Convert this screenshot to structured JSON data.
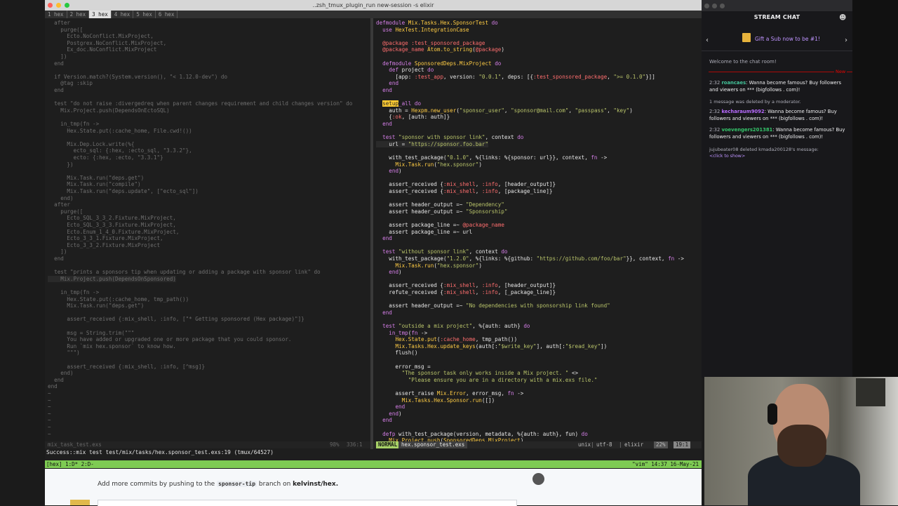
{
  "terminal": {
    "title": "..zsh_tmux_plugin_run new-session -s elixir",
    "tabs": [
      {
        "label": "1 hex",
        "active": false
      },
      {
        "label": "2 hex",
        "active": false
      },
      {
        "label": "3 hex",
        "active": true
      },
      {
        "label": "4 hex",
        "active": false
      },
      {
        "label": "5 hex",
        "active": false
      },
      {
        "label": "6 hex",
        "active": false
      }
    ],
    "left_lines": [
      "  after",
      "    purge([",
      "      Ecto.NoConflict.MixProject,",
      "      Postgrex.NoConflict.MixProject,",
      "      Ex_doc.NoConflict.MixProject",
      "    ])",
      "  end",
      "",
      "  if Version.match?(System.version(), \"< 1.12.0-dev\") do",
      "    @tag :skip",
      "  end",
      "",
      "  test \"do not raise :divergedreq when parent changes requirement and child changes version\" do",
      "    Mix.Project.push(DependsOnEctoSQL)",
      "",
      "    in_tmp(fn ->",
      "      Hex.State.put(:cache_home, File.cwd!())",
      "",
      "      Mix.Dep.Lock.write(%{",
      "        ecto_sql: {:hex, :ecto_sql, \"3.3.2\"},",
      "        ecto: {:hex, :ecto, \"3.3.1\"}",
      "      })",
      "",
      "      Mix.Task.run(\"deps.get\")",
      "      Mix.Task.run(\"compile\")",
      "      Mix.Task.run(\"deps.update\", [\"ecto_sql\"])",
      "    end)",
      "  after",
      "    purge([",
      "      Ecto_SQL_3_3_2.Fixture.MixProject,",
      "      Ecto_SQL_3_3_3.Fixture.MixProject,",
      "      Ecto.Enum_1_4_0.Fixture.MixProject,",
      "      Ecto_3_3_1.Fixture.MixProject,",
      "      Ecto_3_3_2.Fixture.MixProject",
      "    ])",
      "  end",
      "",
      "  test \"prints a sponsors tip when updating or adding a package with sponsor link\" do",
      "    Mix.Project.push(DependsOnSponsored)",
      "",
      "    in_tmp(fn ->",
      "      Hex.State.put(:cache_home, tmp_path())",
      "      Mix.Task.run(\"deps.get\")",
      "",
      "      assert_received {:mix_shell, :info, [\"* Getting sponsored (Hex package)\"]}",
      "",
      "      msg = String.trim(\"\"\"",
      "      You have added or upgraded one or more package that you could sponsor.",
      "      Run `mix hex.sponsor` to know how.",
      "      \"\"\")",
      "",
      "      assert_received {:mix_shell, :info, [^msg]}",
      "    end)",
      "  end",
      "end",
      "~",
      "~",
      "~",
      "~",
      "~",
      "~",
      "~"
    ],
    "right_lines": [
      "defmodule Mix.Tasks.Hex.SponsorTest do",
      "  use HexTest.IntegrationCase",
      "",
      "  @package :test_sponsored_package",
      "  @package_name Atom.to_string(@package)",
      "",
      "  defmodule SponsoredDeps.MixProject do",
      "    def project do",
      "      [app: :test_app, version: \"0.0.1\", deps: [{:test_sponsored_package, \">= 0.1.0\"}]]",
      "    end",
      "  end",
      "",
      "  setup_all do",
      "    auth = Hexpm.new_user(\"sponsor_user\", \"sponsor@mail.com\", \"passpass\", \"key\")",
      "    {:ok, [auth: auth]}",
      "  end",
      "",
      "  test \"sponsor with sponsor link\", context do",
      "    url = \"https://sponsor.foo.bar\"",
      "",
      "    with_test_package(\"0.1.0\", %{links: %{sponsor: url}}, context, fn ->",
      "      Mix.Task.run(\"hex.sponsor\")",
      "    end)",
      "",
      "    assert_received {:mix_shell, :info, [header_output]}",
      "    assert_received {:mix_shell, :info, [package_line]}",
      "",
      "    assert header_output =~ \"Dependency\"",
      "    assert header_output =~ \"Sponsorship\"",
      "",
      "    assert package_line =~ @package_name",
      "    assert package_line =~ url",
      "  end",
      "",
      "  test \"without sponsor link\", context do",
      "    with_test_package(\"1.2.0\", %{links: %{github: \"https://github.com/foo/bar\"}}, context, fn ->",
      "      Mix.Task.run(\"hex.sponsor\")",
      "    end)",
      "",
      "    assert_received {:mix_shell, :info, [header_output]}",
      "    refute_received {:mix_shell, :info, [_package_line]}",
      "",
      "    assert header_output =~ \"No dependencies with sponsorship link found\"",
      "  end",
      "",
      "  test \"outside a mix project\", %{auth: auth} do",
      "    in_tmp(fn ->",
      "      Hex.State.put(:cache_home, tmp_path())",
      "      Mix.Tasks.Hex.update_keys(auth[:\"$write_key\"], auth[:\"$read_key\"])",
      "      flush()",
      "",
      "      error_msg =",
      "        \"The sponsor task only works inside a Mix project. \" <>",
      "          \"Please ensure you are in a directory with a mix.exs file.\"",
      "",
      "      assert_raise Mix.Error, error_msg, fn ->",
      "        Mix.Tasks.Hex.Sponsor.run([])",
      "      end",
      "    end)",
      "  end",
      "",
      "  defp with_test_package(version, metadata, %{auth: auth}, fun) do",
      "    Mix.Project.push(SponsoredDeps.MixProject)"
    ],
    "status_left": {
      "file": "mix_task_test.exs",
      "percent": "98%",
      "position": "336:1"
    },
    "status_right": {
      "mode": "NORMAL",
      "file": "hex.sponsor_test.exs",
      "format": "unix",
      "encoding": "utf-8",
      "filetype": "elixir",
      "percent": "22%",
      "position": "19:1"
    },
    "command_line": "Success::mix test test/mix/tasks/hex.sponsor_test.exs:19 (tmux/64527)",
    "tmux_left": "[hex] 1:D* 2:D-",
    "tmux_right": "\"vim\" 14:37 16-May-21"
  },
  "web": {
    "commit_prefix": "Add more commits by pushing to the",
    "branch": "sponsor-tip",
    "commit_mid": "branch on",
    "repo": "kelvinst/hex."
  },
  "chat": {
    "title": "STREAM CHAT",
    "banner": "Gift a Sub now to be #1!",
    "welcome": "Welcome to the chat room!",
    "new_label": "New",
    "messages": [
      {
        "time": "2:32",
        "user": "roancaes",
        "text": " Wanna become famous? Buy followers and viewers on *** (bigfollows . com)!"
      },
      {
        "time": "2:32",
        "user": "kecharaum9092",
        "text": " Wanna become famous? Buy followers and viewers on *** (bigfollows . com)!"
      },
      {
        "time": "2:32",
        "user": "voevengers201381",
        "text": " Wanna become famous? Buy followers and viewers on *** (bigfollows . com)!"
      }
    ],
    "system_deleted": "1 message was deleted by a moderator.",
    "deleted_notice": "jujubeater08 deleted kmada200128's message:",
    "click_to_show": "<click to show>",
    "colors": {
      "accent": "#bf94ff",
      "background": "#18181b",
      "new_marker": "#eb0400"
    }
  }
}
